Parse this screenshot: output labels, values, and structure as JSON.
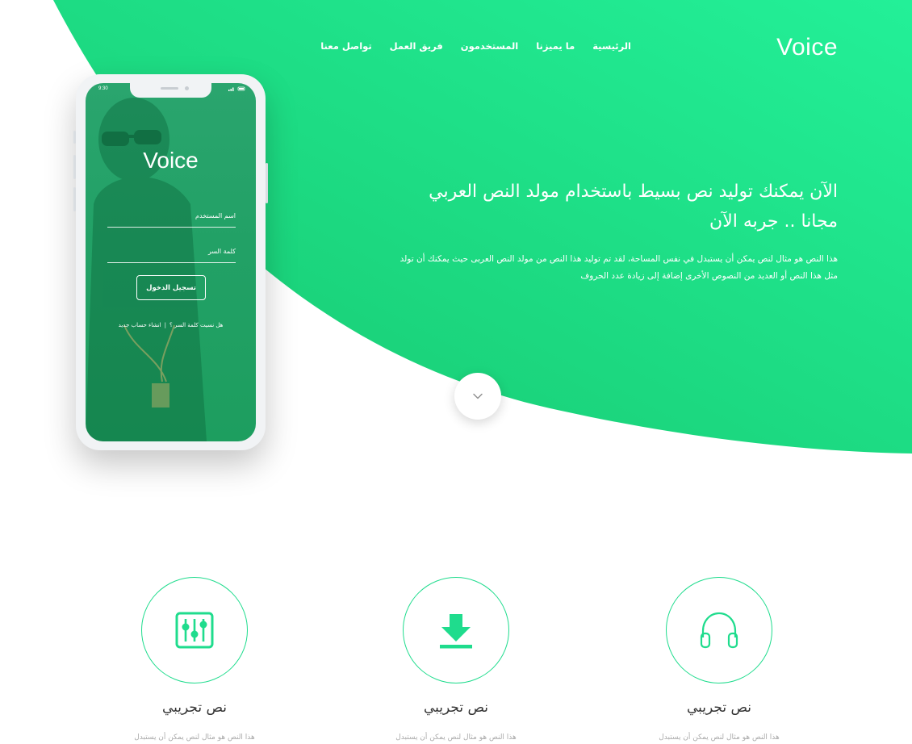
{
  "brand": {
    "logo": "Voice"
  },
  "nav": {
    "items": [
      {
        "label": "الرئيسية"
      },
      {
        "label": "ما يميزنا"
      },
      {
        "label": "المستخدمون"
      },
      {
        "label": "فريق العمل"
      },
      {
        "label": "تواصل معنا"
      }
    ]
  },
  "hero": {
    "title": "الآن يمكنك توليد نص بسيط باستخدام مولد النص العربي مجانا .. جربه الآن",
    "text": "هذا النص هو مثال لنص يمكن أن يستبدل في نفس المساحة، لقد تم توليد هذا النص من مولد النص العربى حيث يمكنك أن تولد مثل هذا النص أو العديد من النصوص الأخرى إضافة إلى زيادة عدد الحروف",
    "scroll_icon": "chevron-down-icon"
  },
  "phone": {
    "time": "9:30",
    "status_icons": "signal-wifi-battery-icons",
    "logo": "Voice",
    "username_placeholder": "اسم المستخدم",
    "password_placeholder": "كلمة السر",
    "login_label": "تسجيل الدخول",
    "forgot_label": "هل نسيت كلمة السر ؟",
    "separator": "|",
    "signup_label": "انشاء حساب جديد"
  },
  "features": [
    {
      "icon": "headphones-icon",
      "title": "نص تجريبي",
      "text": "هذا النص هو مثال لنص يمكن أن يستبدل"
    },
    {
      "icon": "download-icon",
      "title": "نص تجريبي",
      "text": "هذا النص هو مثال لنص يمكن أن يستبدل"
    },
    {
      "icon": "equalizer-icon",
      "title": "نص تجريبي",
      "text": "هذا النص هو مثال لنص يمكن أن يستبدل"
    }
  ],
  "colors": {
    "accent": "#1fdc8d",
    "gradient_light": "#23f098",
    "gradient_dark": "#17c76f",
    "heading": "#333333",
    "muted": "#aaaaaa"
  }
}
